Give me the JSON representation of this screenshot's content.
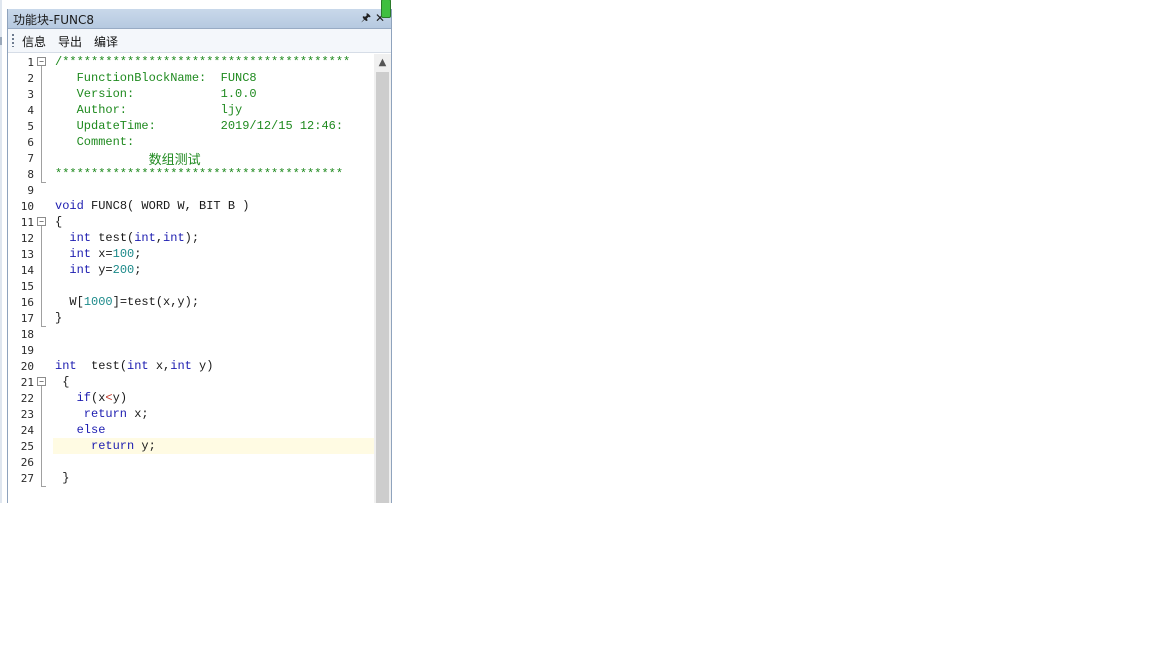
{
  "panel": {
    "title": "功能块-FUNC8",
    "pin_icon": "pin-icon",
    "close_icon": "close-icon"
  },
  "toolbar": {
    "info_label": "信息",
    "export_label": "导出",
    "compile_label": "编译"
  },
  "editor": {
    "current_line": 25,
    "lines": [
      {
        "n": "1"
      },
      {
        "n": "2"
      },
      {
        "n": "3"
      },
      {
        "n": "4"
      },
      {
        "n": "5"
      },
      {
        "n": "6"
      },
      {
        "n": "7"
      },
      {
        "n": "8"
      },
      {
        "n": "9"
      },
      {
        "n": "10"
      },
      {
        "n": "11"
      },
      {
        "n": "12"
      },
      {
        "n": "13"
      },
      {
        "n": "14"
      },
      {
        "n": "15"
      },
      {
        "n": "16"
      },
      {
        "n": "17"
      },
      {
        "n": "18"
      },
      {
        "n": "19"
      },
      {
        "n": "20"
      },
      {
        "n": "21"
      },
      {
        "n": "22"
      },
      {
        "n": "23"
      },
      {
        "n": "24"
      },
      {
        "n": "25"
      },
      {
        "n": "26"
      },
      {
        "n": "27"
      }
    ],
    "code": {
      "l1": "/****************************************",
      "l2": "   FunctionBlockName:  FUNC8",
      "l3": "   Version:            1.0.0",
      "l4": "   Author:             ljy",
      "l5": "   UpdateTime:         2019/12/15 12:46:",
      "l6": "   Comment:",
      "l7": "            数组测试",
      "l8": "****************************************",
      "l10_a": "void",
      "l10_b": " FUNC8( WORD W, BIT B )",
      "l11": "{",
      "l12_a": "  int",
      "l12_b": " test(",
      "l12_c": "int",
      "l12_d": ",",
      "l12_e": "int",
      "l12_f": ");",
      "l13_a": "  int",
      "l13_b": " x=",
      "l13_c": "100",
      "l13_d": ";",
      "l14_a": "  int",
      "l14_b": " y=",
      "l14_c": "200",
      "l14_d": ";",
      "l16_a": "  W[",
      "l16_b": "1000",
      "l16_c": "]=test(x,y);",
      "l17": "}",
      "l20_a": "int",
      "l20_b": "  test(",
      "l20_c": "int",
      "l20_d": " x,",
      "l20_e": "int",
      "l20_f": " y)",
      "l21": " {",
      "l22_a": "   if",
      "l22_b": "(x",
      "l22_c": "<",
      "l22_d": "y)",
      "l23_a": "    return",
      "l23_b": " x;",
      "l24": "   else",
      "l25_a": "     return",
      "l25_b": " y;",
      "l27": " }"
    }
  }
}
